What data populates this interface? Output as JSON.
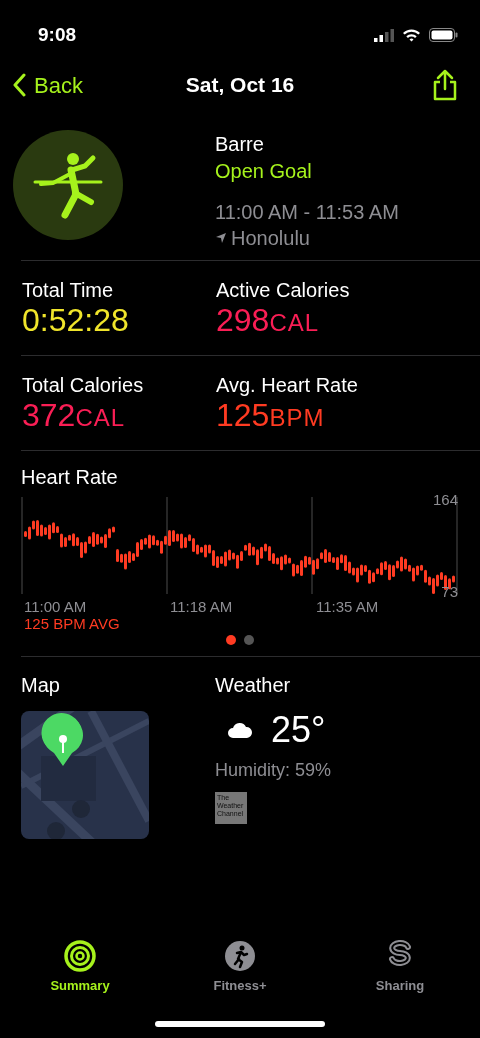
{
  "status_bar": {
    "time": "9:08"
  },
  "nav": {
    "back": "Back",
    "title": "Sat, Oct 16"
  },
  "workout": {
    "name": "Barre",
    "goal": "Open Goal",
    "time_range": "11:00 AM - 11:53 AM",
    "location": "Honolulu"
  },
  "stats": [
    {
      "label": "Total Time",
      "value": "0:52:28",
      "color": "#f0e52b"
    },
    {
      "label": "Active Calories",
      "value": "298",
      "unit": "CAL",
      "color": "#fa1e55"
    },
    {
      "label": "Total Calories",
      "value": "372",
      "unit": "CAL",
      "color": "#fa1e55"
    },
    {
      "label": "Avg. Heart Rate",
      "value": "125",
      "unit": "BPM",
      "color": "#ff3b22"
    }
  ],
  "heart_rate": {
    "title": "Heart Rate",
    "max_label": "164",
    "min_label": "73",
    "times": [
      "11:00 AM",
      "11:18 AM",
      "11:35 AM"
    ],
    "average": "125 BPM AVG"
  },
  "pages": [
    {
      "selected": true
    },
    {
      "selected": false
    }
  ],
  "map": {
    "title": "Map"
  },
  "weather": {
    "title": "Weather",
    "temperature": "25°",
    "humidity": "Humidity: 59%",
    "provider": "The Weather Channel"
  },
  "tabs": [
    {
      "label": "Summary",
      "kind": "rings",
      "selected": true
    },
    {
      "label": "Fitness+",
      "kind": "runner",
      "selected": false
    },
    {
      "label": "Sharing",
      "kind": "sharing",
      "selected": false
    }
  ]
}
